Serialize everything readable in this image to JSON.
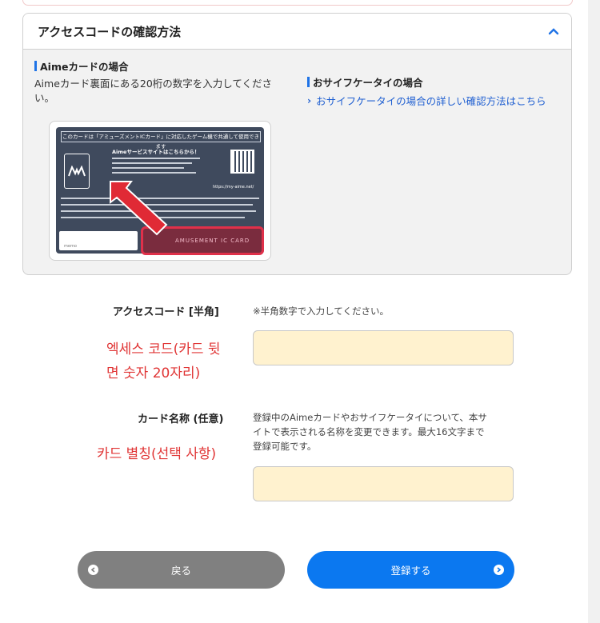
{
  "panel": {
    "title": "アクセスコードの確認方法",
    "aime": {
      "title": "Aimeカードの場合",
      "desc_line1": "Aimeカード裏面にある20桁の数字を入力してくださ",
      "desc_line2": "い。"
    },
    "osaifu": {
      "title": "おサイフケータイの場合",
      "link": "おサイフケータイの場合の詳しい確認方法はこちら"
    },
    "card_image": {
      "top_text": "このカードは「アミューズメントICカード」に対応したゲーム機で共通して使用できます",
      "service_text": "Aimeサービスサイトはこちらから！",
      "url_text": "https://my-aime.net/",
      "memo": "memo",
      "code_text": "AMUSEMENT IC CARD"
    }
  },
  "form": {
    "access_code": {
      "label": "アクセスコード [半角]",
      "note": "※半角数字で入力してください。",
      "value": "",
      "annotation_line1": "엑세스 코드(카드 뒷",
      "annotation_line2": "면 숫자 20자리)"
    },
    "card_name": {
      "label": "カード名称 (任意)",
      "note_line1": "登録中のAimeカードやおサイフケータイについて、本サ",
      "note_line2": "イトで表示される名称を変更できます。最大16文字まで",
      "note_line3": "登録可能です。",
      "value": "",
      "annotation": "카드 별칭(선택 사항)"
    }
  },
  "buttons": {
    "back": "戻る",
    "register": "登録する"
  },
  "colors": {
    "accent_blue": "#0b78f0",
    "back_gray": "#808080",
    "input_bg": "#fff2cf",
    "annotation_red": "#e03535"
  }
}
